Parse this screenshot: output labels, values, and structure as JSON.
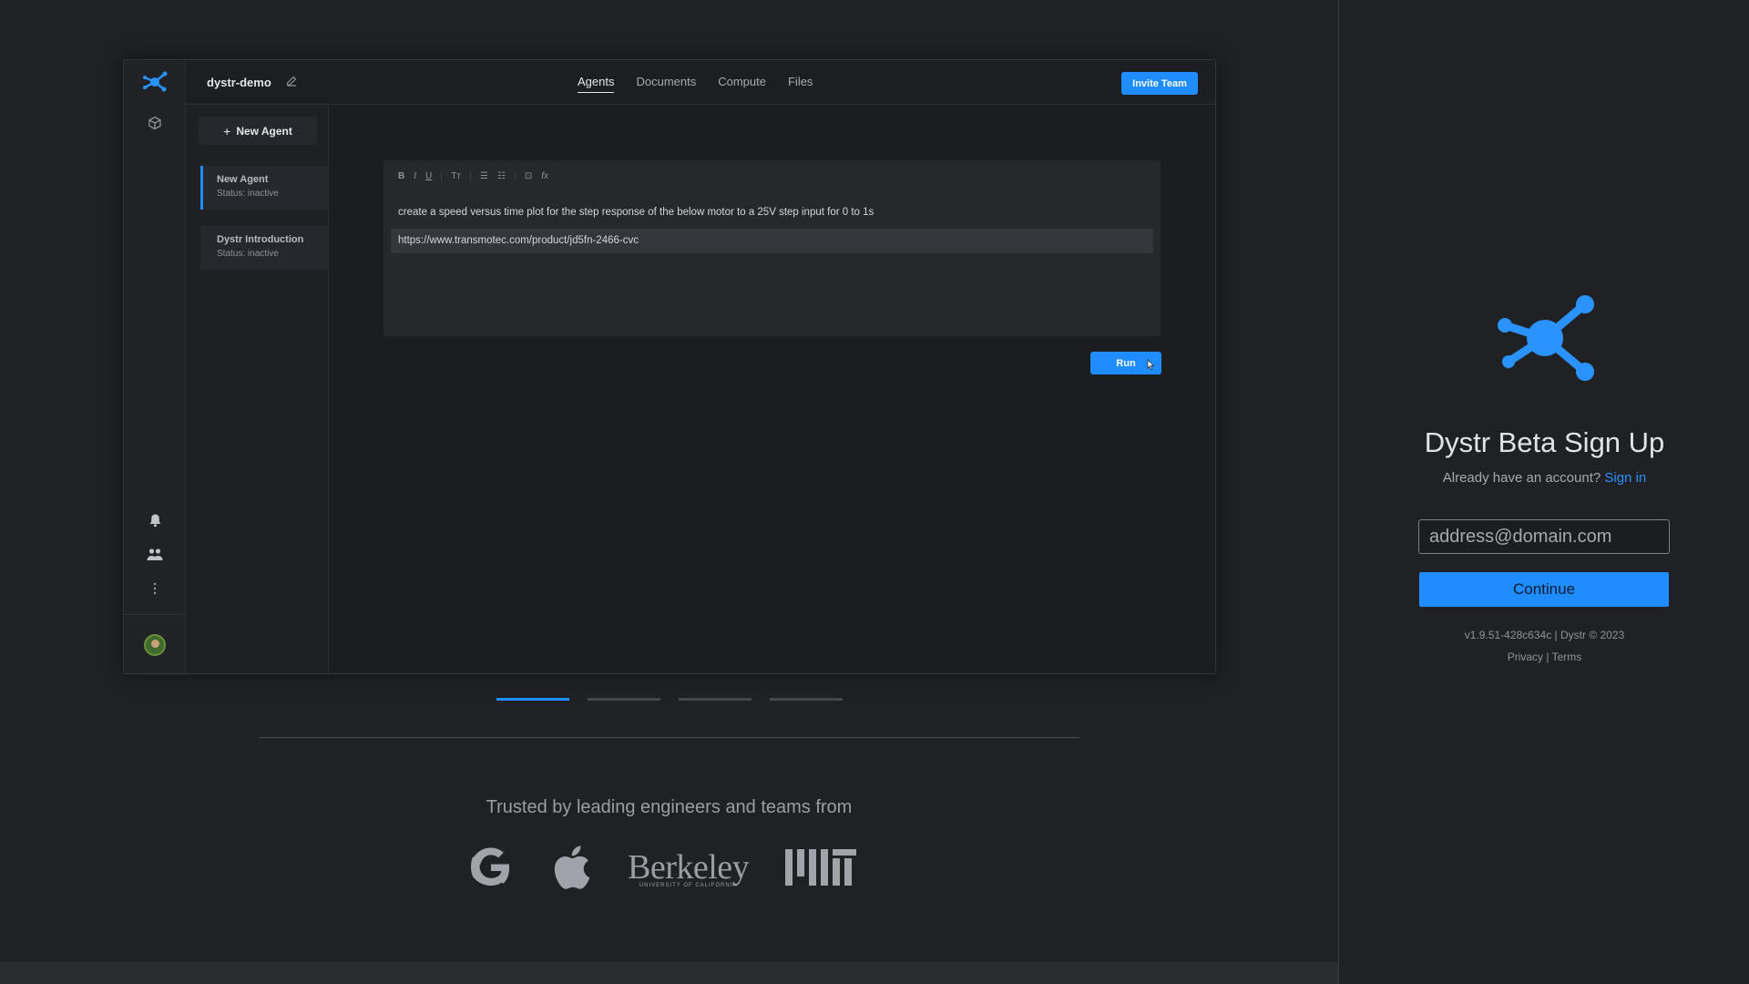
{
  "preview": {
    "project_name": "dystr-demo",
    "tabs": [
      {
        "label": "Agents",
        "active": true
      },
      {
        "label": "Documents",
        "active": false
      },
      {
        "label": "Compute",
        "active": false
      },
      {
        "label": "Files",
        "active": false
      }
    ],
    "invite_label": "Invite Team",
    "new_agent_label": "New Agent",
    "agents": [
      {
        "name": "New Agent",
        "status": "Status: inactive",
        "active": true
      },
      {
        "name": "Dystr Introduction",
        "status": "Status: inactive",
        "active": false
      }
    ],
    "toolbar": [
      "B",
      "I",
      "U",
      "Tт",
      "☰",
      "☷",
      "⊡",
      "fx"
    ],
    "prompt_text": "create a speed versus time plot for the step response of the below motor to a 25V step input for 0 to 1s",
    "url_text": "https://www.transmotec.com/product/jd5fn-2466-cvc",
    "run_label": "Run",
    "icons": [
      "dystr-logo-icon",
      "cube-icon",
      "bell-icon",
      "team-icon",
      "more-vertical-icon",
      "avatar",
      "pencil-icon",
      "gear-icon"
    ]
  },
  "carousel": {
    "count": 4,
    "active_index": 0
  },
  "trusted_text": "Trusted by leading engineers and teams from",
  "logos": {
    "berkeley_main": "Berkeley",
    "berkeley_sub": "UNIVERSITY OF CALIFORNIA"
  },
  "signup": {
    "title": "Dystr Beta Sign Up",
    "have_account": "Already have an account?",
    "sign_in": "Sign in",
    "email_placeholder": "address@domain.com",
    "continue_label": "Continue",
    "version": "v1.9.51-428c634c | Dystr © 2023",
    "privacy": "Privacy",
    "separator": "|",
    "terms": "Terms"
  },
  "colors": {
    "accent": "#1f8cff",
    "background": "#1f2124"
  }
}
